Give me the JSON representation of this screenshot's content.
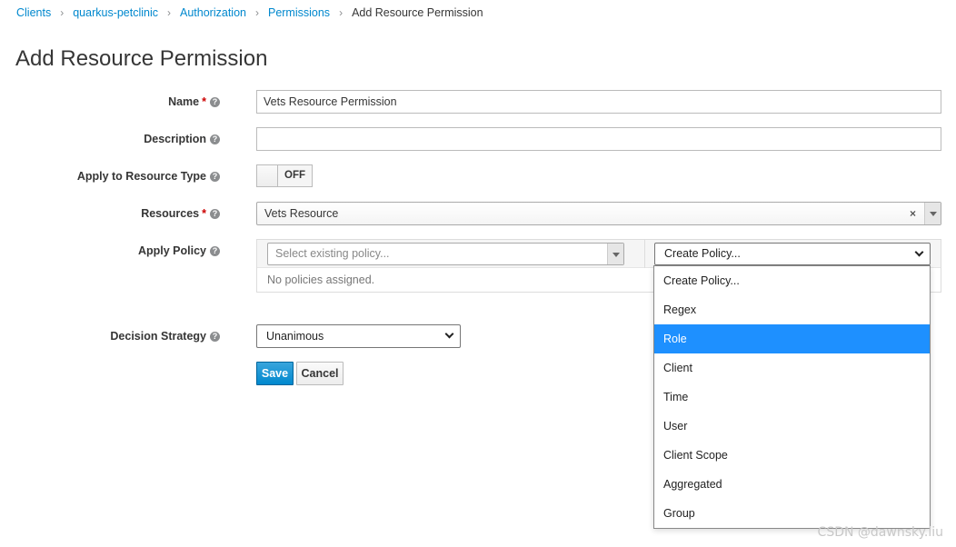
{
  "breadcrumb": [
    {
      "label": "Clients",
      "link": true
    },
    {
      "label": "quarkus-petclinic",
      "link": true
    },
    {
      "label": "Authorization",
      "link": true
    },
    {
      "label": "Permissions",
      "link": true
    },
    {
      "label": "Add Resource Permission",
      "link": false
    }
  ],
  "page_title": "Add Resource Permission",
  "form": {
    "name": {
      "label": "Name",
      "required": "*",
      "value": "Vets Resource Permission"
    },
    "description": {
      "label": "Description",
      "value": ""
    },
    "apply_resource_type": {
      "label": "Apply to Resource Type",
      "state": "OFF"
    },
    "resources": {
      "label": "Resources",
      "required": "*",
      "value": "Vets Resource",
      "clear": "×"
    },
    "apply_policy": {
      "label": "Apply Policy",
      "select_placeholder": "Select existing policy...",
      "create_value": "Create Policy...",
      "empty_text": "No policies assigned."
    },
    "decision_strategy": {
      "label": "Decision Strategy",
      "value": "Unanimous"
    }
  },
  "buttons": {
    "save": "Save",
    "cancel": "Cancel"
  },
  "create_policy_dropdown": {
    "options": [
      "Create Policy...",
      "Regex",
      "Role",
      "Client",
      "Time",
      "User",
      "Client Scope",
      "Aggregated",
      "Group"
    ],
    "highlighted": "Role"
  },
  "watermark": "CSDN @dawnsky.liu",
  "colors": {
    "link": "#0088ce",
    "primary": "#0088ce",
    "highlight": "#1e90ff",
    "required": "#cc0000"
  }
}
